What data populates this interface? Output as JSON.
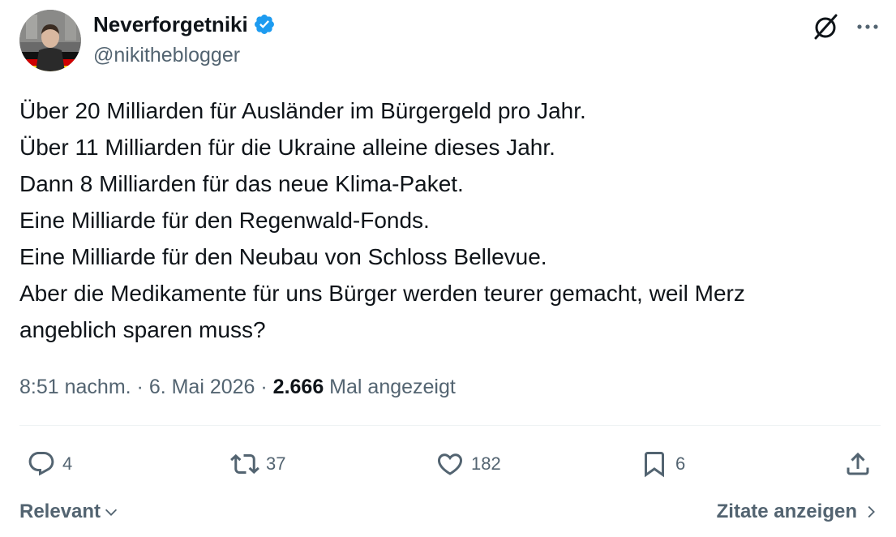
{
  "author": {
    "display_name": "Neverforgetniki",
    "handle": "@nikitheblogger",
    "verified": true,
    "avatar_icon": "profile-photo"
  },
  "header_icons": [
    "grok-icon",
    "more-icon"
  ],
  "tweet": {
    "lines": [
      "Über 20 Milliarden für Ausländer im Bürgergeld pro Jahr.",
      "Über 11 Milliarden für die Ukraine alleine dieses Jahr.",
      "Dann 8 Milliarden für das neue Klima-Paket.",
      "Eine Milliarde für den Regenwald-Fonds.",
      "Eine Milliarde für den Neubau von Schloss Bellevue.",
      "Aber die Medikamente für uns Bürger werden teurer gemacht, weil Merz",
      "angeblich sparen muss?"
    ]
  },
  "meta": {
    "time": "8:51 nachm.",
    "separator": " · ",
    "date": "6. Mai 2026",
    "views_count": "2.666",
    "views_label": " Mal angezeigt"
  },
  "actions": {
    "replies": "4",
    "retweets": "37",
    "likes": "182",
    "bookmarks": "6"
  },
  "footer": {
    "sort_label": "Relevant",
    "quotes_label": "Zitate anzeigen"
  },
  "colors": {
    "text": "#0f1419",
    "secondary": "#536471",
    "verified_blue": "#1d9bf0",
    "divider": "#eff3f4"
  }
}
